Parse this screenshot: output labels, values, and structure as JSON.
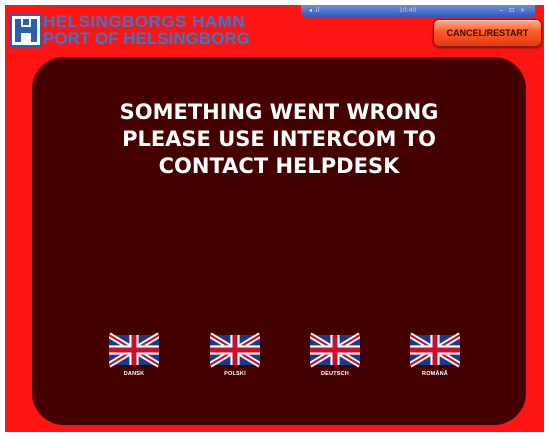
{
  "taskbar": {
    "left_text": "◂ .il",
    "mid_text": "10:40",
    "right_text": "‒ ⊡ ×"
  },
  "header": {
    "brand_line1": "HELSINGBORGS HAMN",
    "brand_line2": "PORT OF HELSINGBORG",
    "cancel_label": "CANCEL/RESTART"
  },
  "main": {
    "message_lines": [
      "SOMETHING WENT WRONG",
      "PLEASE USE INTERCOM TO",
      "CONTACT HELPDESK"
    ],
    "languages": [
      {
        "label": "DANSK",
        "flag_icon": "uk-flag-icon"
      },
      {
        "label": "POLSKI",
        "flag_icon": "uk-flag-icon"
      },
      {
        "label": "DEUTSCH",
        "flag_icon": "uk-flag-icon"
      },
      {
        "label": "ROMÂNĂ",
        "flag_icon": "uk-flag-icon"
      }
    ]
  },
  "colors": {
    "background_red": "#ff1414",
    "panel": "#450000",
    "brand_blue": "#3a78c8",
    "button_orange": "#ff5a2a"
  }
}
